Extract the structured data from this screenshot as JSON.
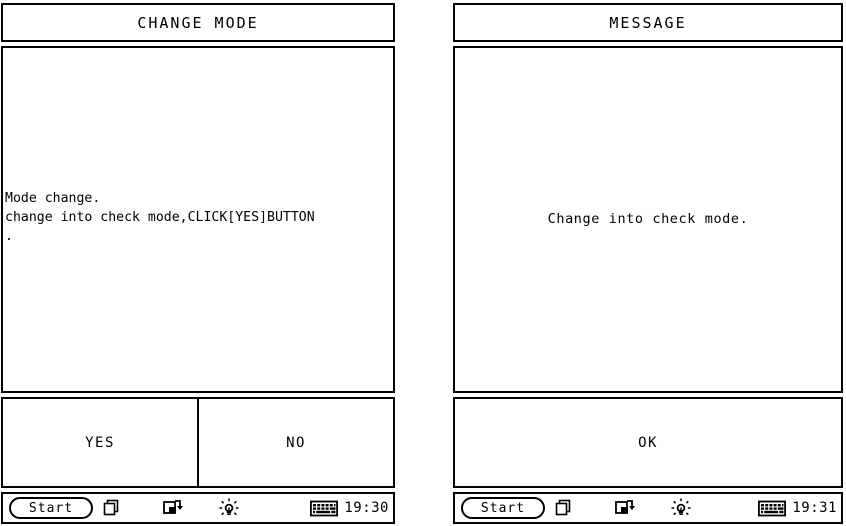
{
  "panels": [
    {
      "id": "change-mode",
      "title": "CHANGE MODE",
      "body_lines": "Mode change.\nchange into check mode,CLICK[YES]BUTTON\n.",
      "buttons": [
        {
          "label": "YES"
        },
        {
          "label": "NO"
        }
      ],
      "taskbar": {
        "start_label": "Start",
        "time": "19:30",
        "icons": [
          "windows-cascade-icon",
          "switch-task-icon",
          "brightness-icon",
          "keyboard-icon"
        ]
      }
    },
    {
      "id": "message",
      "title": "MESSAGE",
      "body_text": "Change into check mode.",
      "buttons": [
        {
          "label": "OK"
        }
      ],
      "taskbar": {
        "start_label": "Start",
        "time": "19:31",
        "icons": [
          "windows-cascade-icon",
          "switch-task-icon",
          "brightness-icon",
          "keyboard-icon"
        ]
      }
    }
  ],
  "colors": {
    "foreground": "#000000",
    "background": "#ffffff"
  }
}
